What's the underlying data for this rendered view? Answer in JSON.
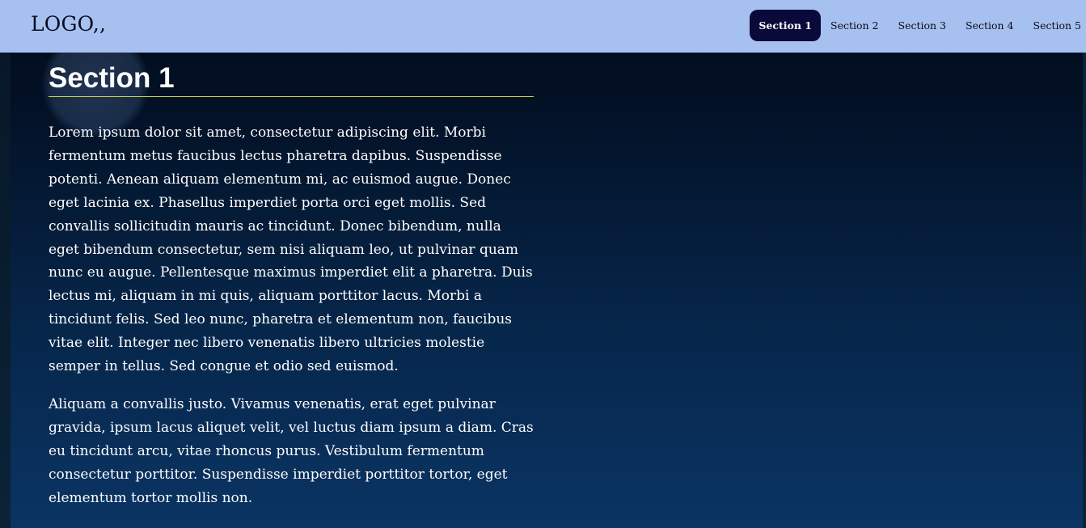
{
  "header": {
    "logo": "LOGO,,",
    "nav": [
      {
        "label": "Section 1",
        "active": true
      },
      {
        "label": "Section 2",
        "active": false
      },
      {
        "label": "Section 3",
        "active": false
      },
      {
        "label": "Section 4",
        "active": false
      },
      {
        "label": "Section 5",
        "active": false
      }
    ]
  },
  "main": {
    "title": "Section 1",
    "paragraphs": [
      "Lorem ipsum dolor sit amet, consectetur adipiscing elit. Morbi fermentum metus faucibus lectus pharetra dapibus. Suspendisse potenti. Aenean aliquam elementum mi, ac euismod augue. Donec eget lacinia ex. Phasellus imperdiet porta orci eget mollis. Sed convallis sollicitudin mauris ac tincidunt. Donec bibendum, nulla eget bibendum consectetur, sem nisi aliquam leo, ut pulvinar quam nunc eu augue. Pellentesque maximus imperdiet elit a pharetra. Duis lectus mi, aliquam in mi quis, aliquam porttitor lacus. Morbi a tincidunt felis. Sed leo nunc, pharetra et elementum non, faucibus vitae elit. Integer nec libero venenatis libero ultricies molestie semper in tellus. Sed congue et odio sed euismod.",
      "Aliquam a convallis justo. Vivamus venenatis, erat eget pulvinar gravida, ipsum lacus aliquet velit, vel luctus diam ipsum a diam. Cras eu tincidunt arcu, vitae rhoncus purus. Vestibulum fermentum consectetur porttitor. Suspendisse imperdiet porttitor tortor, eget elementum tortor mollis non."
    ]
  },
  "colors": {
    "header_bg": "#a6c0f0",
    "active_nav_bg": "#0a0a3a",
    "title_underline": "#c8d94a",
    "background_top": "#020c1b",
    "background_bottom": "#0b3464"
  }
}
